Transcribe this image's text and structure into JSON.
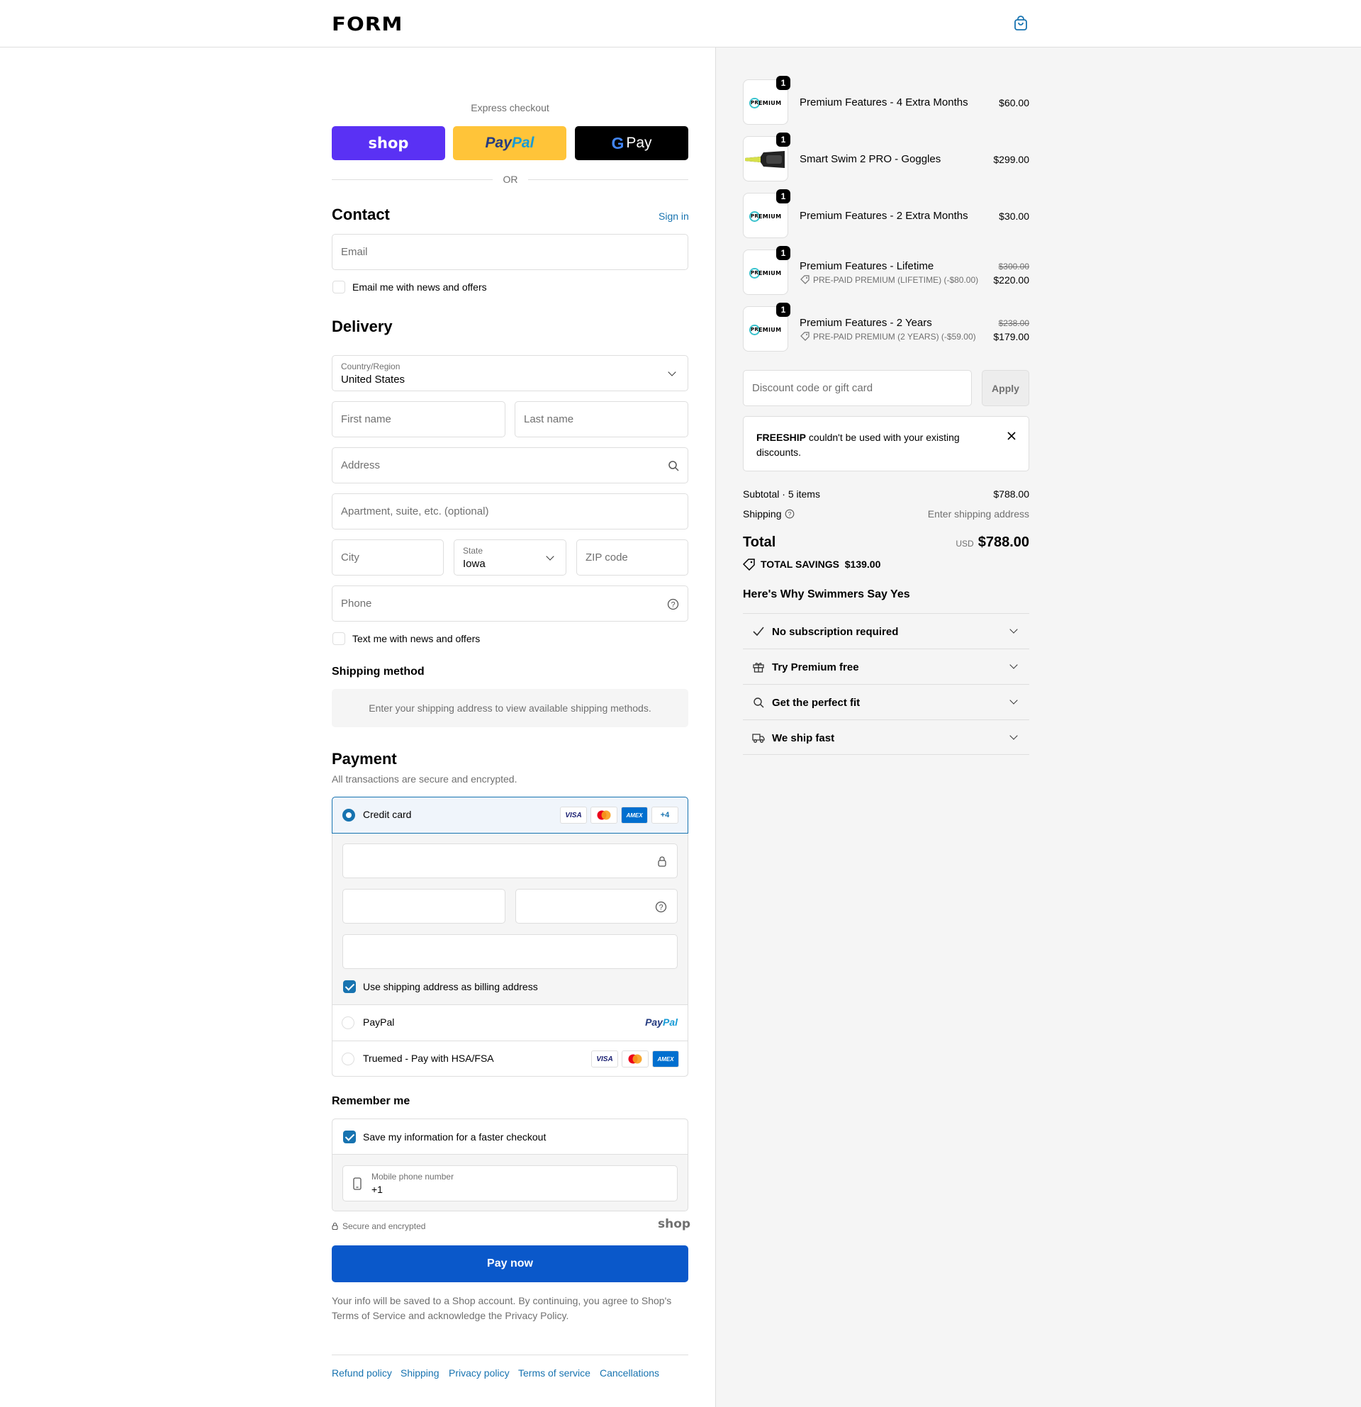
{
  "header": {
    "logo": "FORM",
    "cart_icon": "shopping-bag-icon"
  },
  "express": {
    "title": "Express checkout",
    "shop_label": "shop",
    "paypal_pay": "Pay",
    "paypal_pal": "Pal",
    "gpay_label": "Pay",
    "or": "OR",
    "colors": {
      "shop": "#5a31f4",
      "paypal": "#ffc439",
      "gpay": "#000000"
    }
  },
  "contact": {
    "title": "Contact",
    "sign_in": "Sign in",
    "email_placeholder": "Email",
    "news_label": "Email me with news and offers"
  },
  "delivery": {
    "title": "Delivery",
    "country_label": "Country/Region",
    "country_value": "United States",
    "first_name": "First name",
    "last_name": "Last name",
    "address": "Address",
    "apartment": "Apartment, suite, etc. (optional)",
    "city": "City",
    "state_label": "State",
    "state_value": "Iowa",
    "zip": "ZIP code",
    "phone": "Phone",
    "text_label": "Text me with news and offers"
  },
  "shipping": {
    "title": "Shipping method",
    "notice": "Enter your shipping address to view available shipping methods."
  },
  "payment": {
    "title": "Payment",
    "subtitle": "All transactions are secure and encrypted.",
    "credit_card": "Credit card",
    "cards": [
      "VISA",
      "AMEX"
    ],
    "more_cards": "+4",
    "billing_label": "Use shipping address as billing address",
    "paypal": "PayPal",
    "paypal_logo_pay": "Pay",
    "paypal_logo_pal": "Pal",
    "truemed": "Truemed - Pay with HSA/FSA",
    "accent": "#1773b0"
  },
  "remember": {
    "title": "Remember me",
    "save_label": "Save my information for a faster checkout",
    "mobile_label": "Mobile phone number",
    "mobile_value": "+1",
    "secure": "Secure and encrypted",
    "shop_logo": "shop"
  },
  "pay_now": "Pay now",
  "legal": {
    "line1": "Your info will be saved to a Shop account. By continuing, you agree to Shop's",
    "terms": "Terms of Service",
    "middle": "and acknowledge the",
    "privacy": "Privacy Policy",
    "end": "."
  },
  "footer": [
    "Refund policy",
    "Shipping",
    "Privacy policy",
    "Terms of service",
    "Cancellations"
  ],
  "cart": {
    "items": [
      {
        "name": "Premium Features - 4 Extra Months",
        "qty": "1",
        "price": "$60.00"
      },
      {
        "name": "Smart Swim 2 PRO - Goggles",
        "qty": "1",
        "price": "$299.00"
      },
      {
        "name": "Premium Features - 2 Extra Months",
        "qty": "1",
        "price": "$30.00"
      },
      {
        "name": "Premium Features - Lifetime",
        "qty": "1",
        "original": "$300.00",
        "price": "$220.00",
        "discount": "PRE-PAID PREMIUM (LIFETIME) (-$80.00)"
      },
      {
        "name": "Premium Features - 2 Years",
        "qty": "1",
        "original": "$238.00",
        "price": "$179.00",
        "discount": "PRE-PAID PREMIUM (2 YEARS) (-$59.00)"
      }
    ],
    "premium_logo_a": "PR",
    "premium_logo_b": "EMIUM",
    "discount_placeholder": "Discount code or gift card",
    "apply": "Apply",
    "error_code": "FREESHIP",
    "error_text": " couldn't be used with your existing",
    "error_text2": "discounts.",
    "subtotal_label": "Subtotal · 5 items",
    "subtotal": "$788.00",
    "shipping_label": "Shipping",
    "shipping_value": "Enter shipping address",
    "total_label": "Total",
    "currency": "USD",
    "total": "$788.00",
    "savings_label": "TOTAL SAVINGS",
    "savings": "$139.00"
  },
  "why": {
    "title": "Here's Why Swimmers Say Yes",
    "items": [
      {
        "label": "No subscription required",
        "icon": "check-icon"
      },
      {
        "label": "Try Premium free",
        "icon": "gift-icon"
      },
      {
        "label": "Get the perfect fit",
        "icon": "search-icon"
      },
      {
        "label": "We ship fast",
        "icon": "truck-icon"
      }
    ]
  }
}
